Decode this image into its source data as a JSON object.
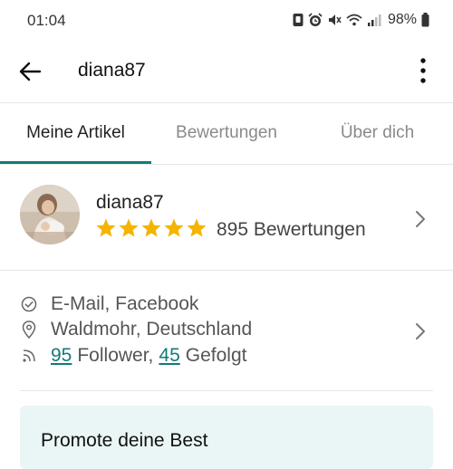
{
  "status_bar": {
    "time": "01:04",
    "battery": "98%",
    "icons": [
      "nfc-icon",
      "alarm-icon",
      "mute-icon",
      "wifi-icon",
      "signal-icon",
      "battery-icon"
    ]
  },
  "app_bar": {
    "title": "diana87",
    "back_icon": "arrow-left-icon",
    "menu_icon": "more-vert-icon"
  },
  "tabs": [
    {
      "label": "Meine Artikel",
      "active": true
    },
    {
      "label": "Bewertungen",
      "active": false
    },
    {
      "label": "Über dich",
      "active": false
    }
  ],
  "profile": {
    "name": "diana87",
    "rating_stars": 5,
    "reviews": "895 Bewertungen"
  },
  "info": {
    "verified": "E-Mail, Facebook",
    "location": "Waldmohr, Deutschland",
    "followers_count": "95",
    "followers_label": "Follower,",
    "following_count": "45",
    "following_label": "Gefolgt"
  },
  "promo": {
    "text": "Promote deine Best"
  },
  "colors": {
    "accent": "#127a7a",
    "star": "#f4b400",
    "promo_bg": "#eaf6f6"
  }
}
